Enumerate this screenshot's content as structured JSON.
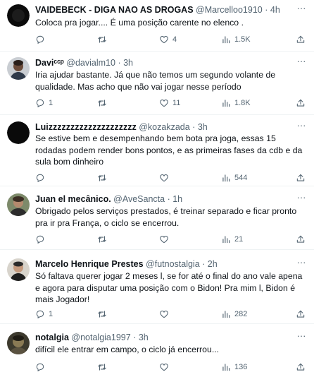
{
  "tweets": [
    {
      "name": "VAIDEBECK - DIGA NAO AS DROGAS",
      "handle": "@Marcelloo1910",
      "time": "4h",
      "text": "Coloca pra jogar.... É uma posição carente no elenco .",
      "replies": "",
      "retweets": "",
      "likes": "4",
      "views": "1.5K",
      "avatar": "avatar-black"
    },
    {
      "name": "Daviᶜᶜᵖ",
      "handle": "@davialm10",
      "time": "3h",
      "text": "Iria ajudar bastante. Já que não temos um segundo volante de qualidade. Mas acho que não vai jogar nesse período",
      "replies": "1",
      "retweets": "",
      "likes": "11",
      "views": "1.8K",
      "avatar": "avatar-person"
    },
    {
      "name": "Luizzzzzzzzzzzzzzzzzzzz",
      "handle": "@kozakzada",
      "time": "3h",
      "text": "Se estive bem e desempenhando bem bota pra joga, essas 15 rodadas podem render bons pontos, e as primeiras fases da cdb e da sula bom dinheiro",
      "replies": "",
      "retweets": "",
      "likes": "",
      "views": "544",
      "avatar": "avatar-black"
    },
    {
      "name": "Juan el mecânico.",
      "handle": "@AveSancta",
      "time": "1h",
      "text": "Obrigado pelos serviços prestados, é treinar separado e ficar pronto pra ir pra França, o ciclo se encerrou.",
      "replies": "",
      "retweets": "",
      "likes": "",
      "views": "21",
      "avatar": "avatar-person"
    },
    {
      "name": "Marcelo Henrique Prestes",
      "handle": "@futnostalgia",
      "time": "2h",
      "text": "Só faltava querer jogar 2 meses l, se for até o final do ano vale apena e agora para disputar uma posição com o Bidon! Pra mim l, Bidon é mais Jogador!",
      "replies": "1",
      "retweets": "",
      "likes": "",
      "views": "282",
      "avatar": "avatar-person"
    },
    {
      "name": "notalgia",
      "handle": "@notalgia1997",
      "time": "3h",
      "text": "difícil ele entrar em campo, o ciclo já encerrou...",
      "replies": "",
      "retweets": "",
      "likes": "",
      "views": "136",
      "avatar": "avatar-person"
    }
  ],
  "separator": "·",
  "icons": {
    "reply": "reply-icon",
    "retweet": "retweet-icon",
    "like": "heart-icon",
    "views": "views-icon",
    "share": "share-icon",
    "more": "more-icon"
  },
  "colors": {
    "text": "#0f1419",
    "secondary": "#536471",
    "divider": "#eff3f4"
  }
}
